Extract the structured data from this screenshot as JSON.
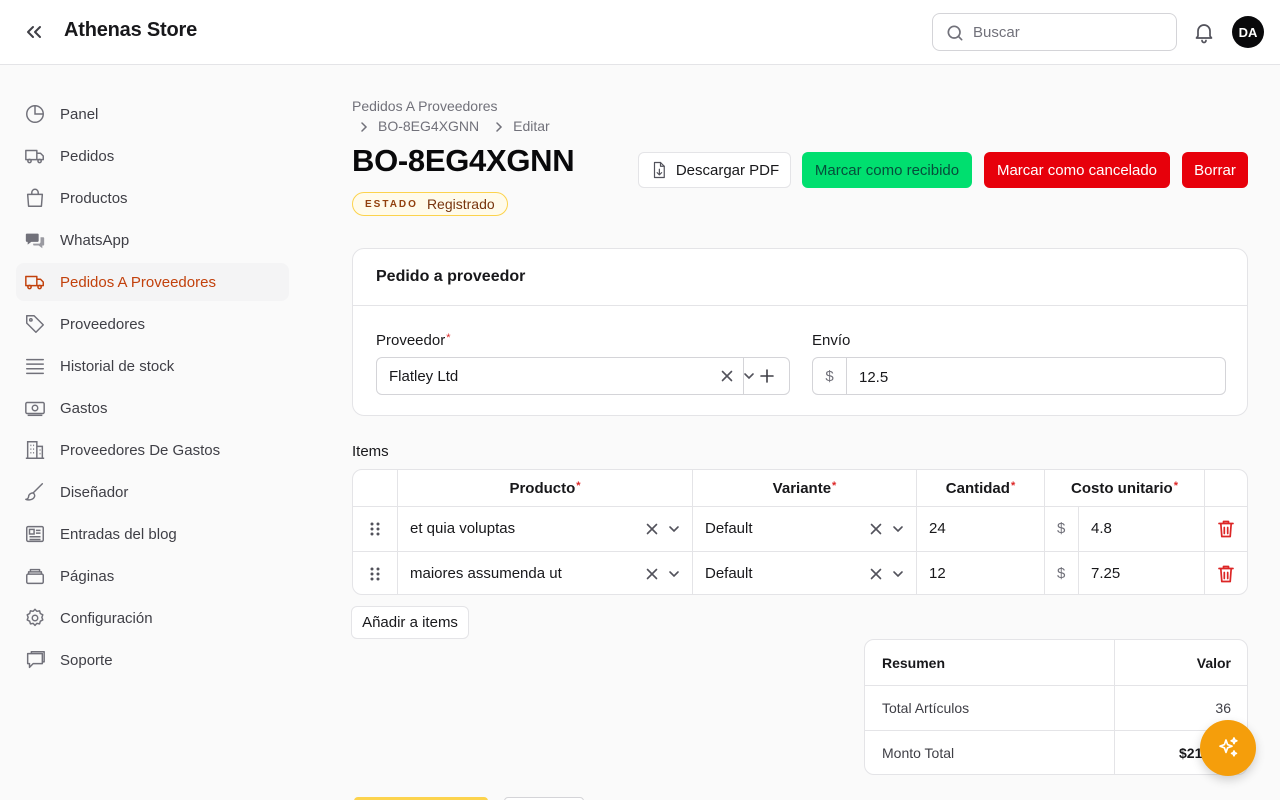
{
  "app": {
    "title": "Athenas Store",
    "avatar_initials": "DA"
  },
  "search": {
    "placeholder": "Buscar",
    "value": ""
  },
  "sidebar": {
    "items": [
      {
        "label": "Panel",
        "icon": "pie-chart-icon"
      },
      {
        "label": "Pedidos",
        "icon": "truck-icon"
      },
      {
        "label": "Productos",
        "icon": "shopping-bag-icon"
      },
      {
        "label": "WhatsApp",
        "icon": "chat-bubbles-icon"
      },
      {
        "label": "Pedidos A Proveedores",
        "icon": "truck-icon",
        "active": true
      },
      {
        "label": "Proveedores",
        "icon": "tag-icon"
      },
      {
        "label": "Historial de stock",
        "icon": "list-icon"
      },
      {
        "label": "Gastos",
        "icon": "banknote-icon"
      },
      {
        "label": "Proveedores De Gastos",
        "icon": "building-icon"
      },
      {
        "label": "Diseñador",
        "icon": "brush-icon"
      },
      {
        "label": "Entradas del blog",
        "icon": "newspaper-icon"
      },
      {
        "label": "Páginas",
        "icon": "stack-icon"
      },
      {
        "label": "Configuración",
        "icon": "gear-icon"
      },
      {
        "label": "Soporte",
        "icon": "chat-icon"
      }
    ]
  },
  "breadcrumb": {
    "root": "Pedidos A Proveedores",
    "current": "BO-8EG4XGNN",
    "action": "Editar"
  },
  "page": {
    "title": "BO-8EG4XGNN",
    "state_label": "ESTADO",
    "state_value": "Registrado"
  },
  "actions": {
    "download_pdf": "Descargar PDF",
    "mark_received": "Marcar como recibido",
    "mark_cancelled": "Marcar como cancelado",
    "delete": "Borrar"
  },
  "supplier_card": {
    "title": "Pedido a proveedor",
    "supplier_label": "Proveedor",
    "supplier_value": "Flatley Ltd",
    "shipping_label": "Envío",
    "currency": "$",
    "shipping_value": "12.5"
  },
  "items": {
    "label": "Items",
    "headers": {
      "product": "Producto",
      "variant": "Variante",
      "quantity": "Cantidad",
      "unit_cost": "Costo unitario"
    },
    "rows": [
      {
        "product": "et quia voluptas",
        "variant": "Default",
        "quantity": "24",
        "currency": "$",
        "unit_cost": "4.8"
      },
      {
        "product": "maiores assumenda ut",
        "variant": "Default",
        "quantity": "12",
        "currency": "$",
        "unit_cost": "7.25"
      }
    ],
    "add_label": "Añadir a items"
  },
  "summary": {
    "header_label": "Resumen",
    "header_value": "Valor",
    "rows": [
      {
        "label": "Total Artículos",
        "value": "36"
      },
      {
        "label": "Monto Total",
        "value": "$21"
      }
    ]
  },
  "colors": {
    "accent": "#c2410c",
    "success": "#00df6f",
    "danger": "#e7000b",
    "fab": "#f59e0b"
  }
}
